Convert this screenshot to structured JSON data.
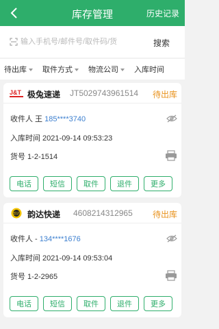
{
  "header": {
    "title": "库存管理",
    "history_label": "历史记录"
  },
  "search": {
    "placeholder": "输入手机号/邮件号/取件码/货",
    "button": "搜索"
  },
  "filters": [
    "待出库",
    "取件方式",
    "物流公司",
    "入库时间"
  ],
  "colors": {
    "accent": "#2eae6b",
    "status": "#e8911b",
    "phone": "#3c7fcf"
  },
  "cards": [
    {
      "logo": "J&T",
      "carrier": "极兔速递",
      "tracking": "JT5029743961514",
      "status": "待出库",
      "recipient_label": "收件人 王",
      "phone": "185****3740",
      "time": "入库时间 2021-09-14 09:53:23",
      "shelf": "货号 1-2-1514"
    },
    {
      "logo": "韵达",
      "carrier": "韵达快递",
      "tracking": "4608214312965",
      "status": "待出库",
      "recipient_label": "收件人 -",
      "phone": "134****1676",
      "time": "入库时间 2021-09-14 09:53:04",
      "shelf": "货号 1-2-2965"
    }
  ],
  "actions": [
    "电话",
    "短信",
    "取件",
    "退件",
    "更多"
  ]
}
